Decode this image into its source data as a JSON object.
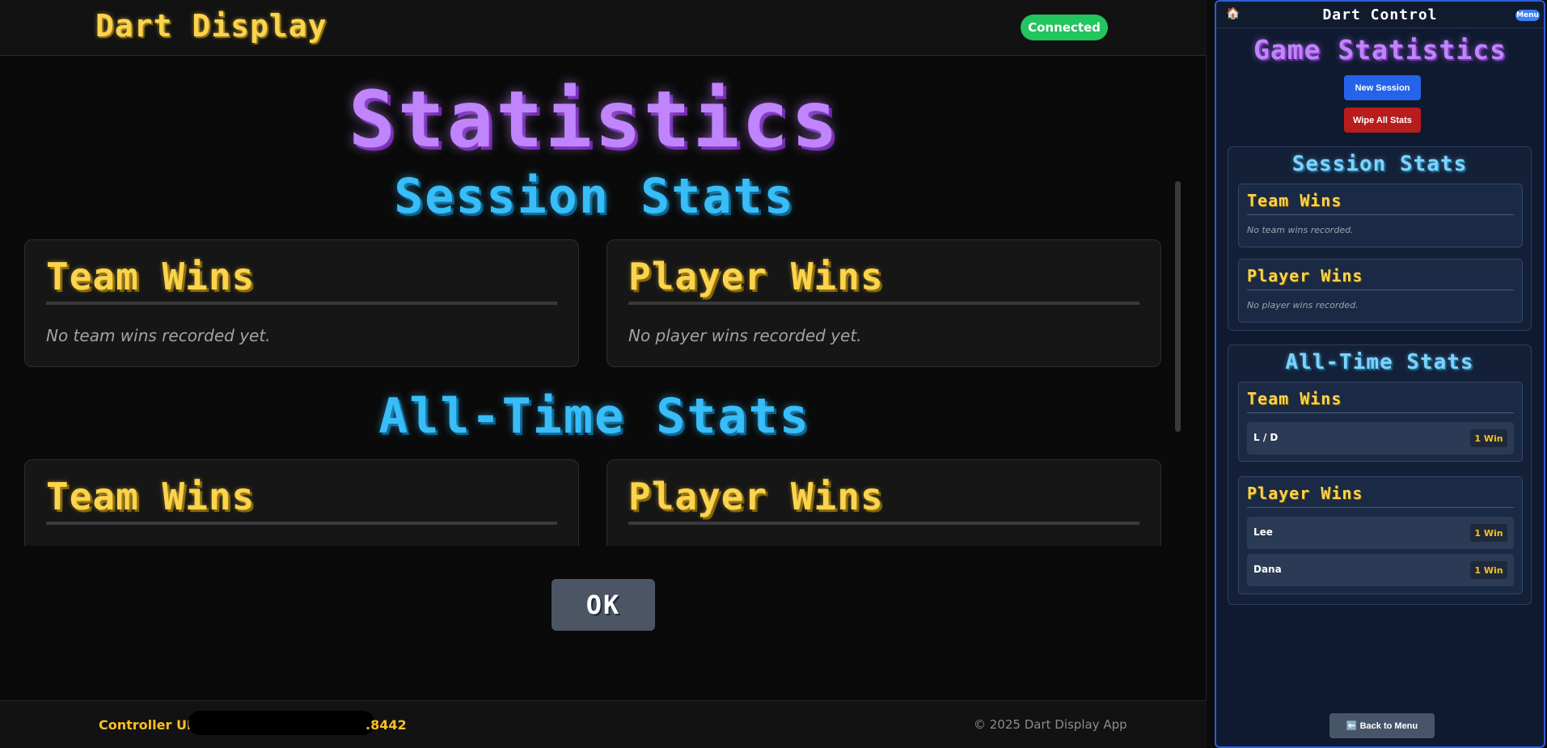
{
  "display": {
    "brand": "Dart Display",
    "connection_status": "Connected",
    "title": "Statistics",
    "session": {
      "heading": "Session Stats",
      "team_title": "Team Wins",
      "team_empty": "No team wins recorded yet.",
      "player_title": "Player Wins",
      "player_empty": "No player wins recorded yet."
    },
    "alltime": {
      "heading": "All-Time Stats",
      "team_title": "Team Wins",
      "player_title": "Player Wins"
    },
    "ok_label": "OK",
    "footer": {
      "controller_label": "Controller URL",
      "controller_port": ".8442",
      "copyright": "© 2025 Dart Display App"
    }
  },
  "control": {
    "title": "Dart Control",
    "menu_label": "Menu",
    "home_icon": "🏠",
    "page_title": "Game Statistics",
    "new_session_label": "New Session",
    "wipe_label": "Wipe All Stats",
    "session": {
      "heading": "Session Stats",
      "team_title": "Team Wins",
      "team_empty": "No team wins recorded.",
      "player_title": "Player Wins",
      "player_empty": "No player wins recorded."
    },
    "alltime": {
      "heading": "All-Time Stats",
      "team_title": "Team Wins",
      "teams": [
        {
          "name": "L / D",
          "wins": "1 Win"
        }
      ],
      "player_title": "Player Wins",
      "players": [
        {
          "name": "Lee",
          "wins": "1 Win"
        },
        {
          "name": "Dana",
          "wins": "1 Win"
        }
      ]
    },
    "back_label": "⬅️ Back to Menu"
  }
}
